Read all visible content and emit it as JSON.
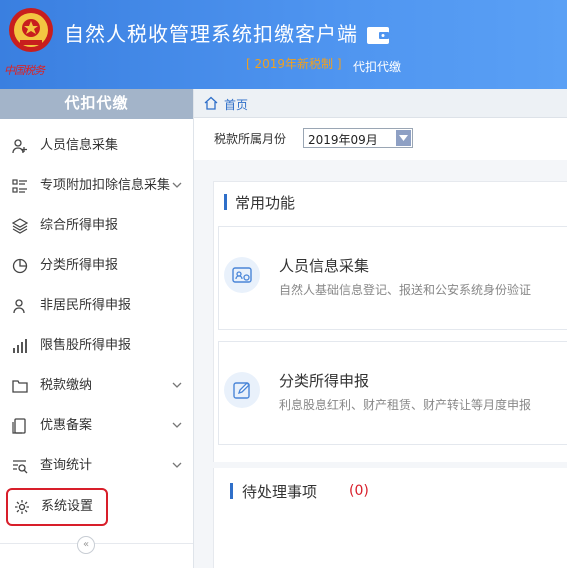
{
  "header": {
    "emblem_caption": "中国税务",
    "app_title": "自然人税收管理系统扣缴客户端",
    "version": "[ 2019年新税制 ]",
    "module": "代扣代缴",
    "accent": "#3a7fe0"
  },
  "sidebar": {
    "title": "代扣代缴",
    "items": [
      {
        "label": "人员信息采集",
        "icon": "person-add-icon",
        "expandable": false
      },
      {
        "label": "专项附加扣除信息采集",
        "icon": "list-icon",
        "expandable": true
      },
      {
        "label": "综合所得申报",
        "icon": "layers-icon",
        "expandable": false
      },
      {
        "label": "分类所得申报",
        "icon": "pie-icon",
        "expandable": false
      },
      {
        "label": "非居民所得申报",
        "icon": "person-icon",
        "expandable": false
      },
      {
        "label": "限售股所得申报",
        "icon": "bar-chart-icon",
        "expandable": false
      },
      {
        "label": "税款缴纳",
        "icon": "folder-icon",
        "expandable": true
      },
      {
        "label": "优惠备案",
        "icon": "document-icon",
        "expandable": true
      },
      {
        "label": "查询统计",
        "icon": "search-list-icon",
        "expandable": true
      },
      {
        "label": "系统设置",
        "icon": "gear-icon",
        "expandable": false,
        "highlighted": true
      }
    ],
    "collapse": "«"
  },
  "breadcrumb": {
    "home": "首页"
  },
  "filter": {
    "label": "税款所属月份",
    "value": "2019年09月"
  },
  "common": {
    "title": "常用功能",
    "cards": [
      {
        "title": "人员信息采集",
        "desc": "自然人基础信息登记、报送和公安系统身份验证"
      },
      {
        "title": "分类所得申报",
        "desc": "利息股息红利、财产租赁、财产转让等月度申报"
      }
    ]
  },
  "todo": {
    "title": "待处理事项",
    "count": "(0)"
  }
}
